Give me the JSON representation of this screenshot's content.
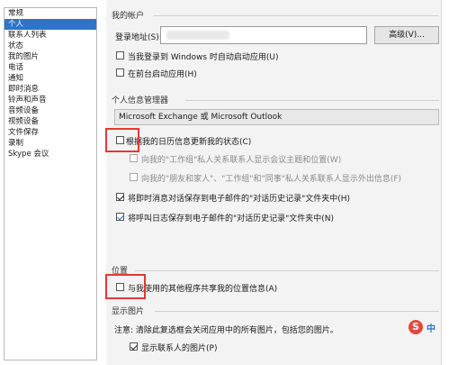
{
  "sidebar": {
    "items": [
      {
        "label": "常规"
      },
      {
        "label": "个人",
        "selected": true
      },
      {
        "label": "联系人列表"
      },
      {
        "label": "状态"
      },
      {
        "label": "我的图片"
      },
      {
        "label": "电话"
      },
      {
        "label": "通知"
      },
      {
        "label": "即时消息"
      },
      {
        "label": "铃声和声音"
      },
      {
        "label": "音频设备"
      },
      {
        "label": "视频设备"
      },
      {
        "label": "文件保存"
      },
      {
        "label": "录制"
      },
      {
        "label": "Skype 会议"
      }
    ]
  },
  "account": {
    "section_title": "我的帐户",
    "login_label": "登录地址(S):",
    "advanced_button": "高级(V)...",
    "auto_start_label": "当我登录到 Windows 时自动启动应用(U)",
    "foreground_label": "在前台启动应用(H)"
  },
  "pim": {
    "section_title": "个人信息管理器",
    "provider_value": "Microsoft Exchange 或 Microsoft Outlook",
    "calendar_status_label": "根据我的日历信息更新我的状态(C)",
    "workgroup_meeting_label": "向我的\"工作组\"私人关系联系人显示会议主题和位置(W)",
    "friends_ooo_label": "向我的\"朋友和家人\"、\"工作组\"和\"同事\"私人关系联系人显示外出信息(F)",
    "save_im_label": "将即时消息对话保存到电子邮件的\"对话历史记录\"文件夹中(H)",
    "save_calls_label": "将呼叫日志保存到电子邮件的\"对话历史记录\"文件夹中(N)"
  },
  "location": {
    "section_title": "位置",
    "share_label": "与我使用的其他程序共享我的位置信息(A)"
  },
  "pictures": {
    "section_title": "显示图片",
    "note": "注意: 清除此复选框会关闭应用中的所有图片，包括您的图片。",
    "show_contacts_pictures_label": "显示联系人的图片(P)"
  },
  "ime": {
    "logo_letter": "S",
    "mode": "中"
  }
}
